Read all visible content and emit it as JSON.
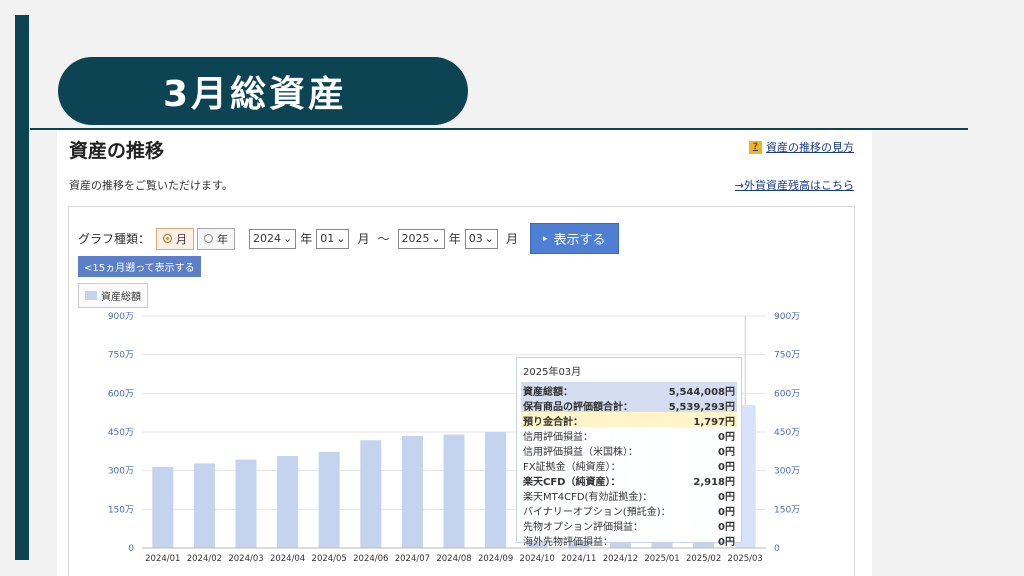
{
  "slide": {
    "title": "3月総資産"
  },
  "panel": {
    "title": "資産の推移",
    "help_link": "資産の推移の見方",
    "help_icon_glyph": "?",
    "description": "資産の推移をご覧いただけます。",
    "foreign_link": "→外貨資産残高はこちら"
  },
  "controls": {
    "graph_type_label": "グラフ種類：",
    "month_label": "月",
    "year_label": "年",
    "from_year": "2024",
    "from_month": "01",
    "to_year": "2025",
    "to_month": "03",
    "year_unit": "年",
    "month_unit": "月",
    "tilde": "〜",
    "show_button": "表示する",
    "back_button": "<15ヵ月遡って表示する",
    "legend_label": "資産総額"
  },
  "chart_data": {
    "type": "bar",
    "categories": [
      "2024/01",
      "2024/02",
      "2024/03",
      "2024/04",
      "2024/05",
      "2024/06",
      "2024/07",
      "2024/08",
      "2024/09",
      "2024/10",
      "2024/11",
      "2024/12",
      "2025/01",
      "2025/02",
      "2025/03"
    ],
    "series": [
      {
        "name": "資産総額",
        "values": [
          3150000,
          3280000,
          3430000,
          3570000,
          3730000,
          4180000,
          4350000,
          4400000,
          4500000,
          4650000,
          4820000,
          5000000,
          5170000,
          5350000,
          5544008
        ]
      }
    ],
    "y_ticks": [
      "0",
      "150万",
      "300万",
      "450万",
      "600万",
      "750万",
      "900万"
    ],
    "ylim": [
      0,
      9000000
    ],
    "bar_color": "#c4d3ee",
    "highlight_color": "#d7e3fb"
  },
  "tooltip": {
    "header": "2025年03月",
    "rows": [
      {
        "label": "資産総額：",
        "value": "5,544,008円"
      },
      {
        "label": "保有商品の評価額合計：",
        "value": "5,539,293円"
      },
      {
        "label": "預り金合計：",
        "value": "1,797円"
      },
      {
        "label": "信用評価損益：",
        "value": "0円"
      },
      {
        "label": "信用評価損益（米国株）：",
        "value": "0円"
      },
      {
        "label": "FX証拠金（純資産）：",
        "value": "0円"
      },
      {
        "label": "楽天CFD（純資産）：",
        "value": "2,918円"
      },
      {
        "label": "楽天MT4CFD(有効証拠金)：",
        "value": "0円"
      },
      {
        "label": "バイナリーオプション(預託金)：",
        "value": "0円"
      },
      {
        "label": "先物オプション評価損益：",
        "value": "0円"
      },
      {
        "label": "海外先物評価損益：",
        "value": "0円"
      }
    ]
  }
}
